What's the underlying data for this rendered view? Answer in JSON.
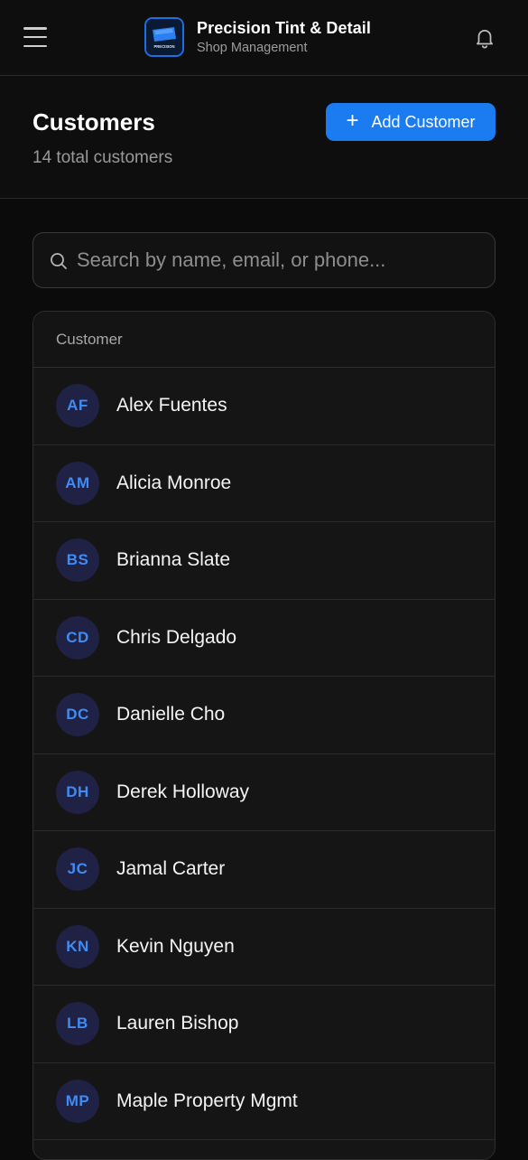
{
  "app": {
    "title": "Precision Tint & Detail",
    "subtitle": "Shop Management",
    "logo_text": "PRECISION"
  },
  "page": {
    "title": "Customers",
    "count_text": "14 total customers",
    "add_button_label": "Add Customer"
  },
  "search": {
    "placeholder": "Search by name, email, or phone...",
    "value": ""
  },
  "table": {
    "column_header": "Customer",
    "rows": [
      {
        "initials": "AF",
        "name": "Alex Fuentes"
      },
      {
        "initials": "AM",
        "name": "Alicia Monroe"
      },
      {
        "initials": "BS",
        "name": "Brianna Slate"
      },
      {
        "initials": "CD",
        "name": "Chris Delgado"
      },
      {
        "initials": "DC",
        "name": "Danielle Cho"
      },
      {
        "initials": "DH",
        "name": "Derek Holloway"
      },
      {
        "initials": "JC",
        "name": "Jamal Carter"
      },
      {
        "initials": "KN",
        "name": "Kevin Nguyen"
      },
      {
        "initials": "LB",
        "name": "Lauren Bishop"
      },
      {
        "initials": "MP",
        "name": "Maple Property Mgmt"
      },
      {
        "initials": "",
        "name": ""
      }
    ]
  },
  "colors": {
    "accent": "#1a7cf0",
    "avatar_bg": "#1f2145",
    "avatar_text": "#3f8cf5",
    "background": "#0b0b0b"
  },
  "icons": {
    "menu": "hamburger-menu-icon",
    "notifications": "bell-icon",
    "search": "search-icon",
    "add": "plus-icon"
  }
}
